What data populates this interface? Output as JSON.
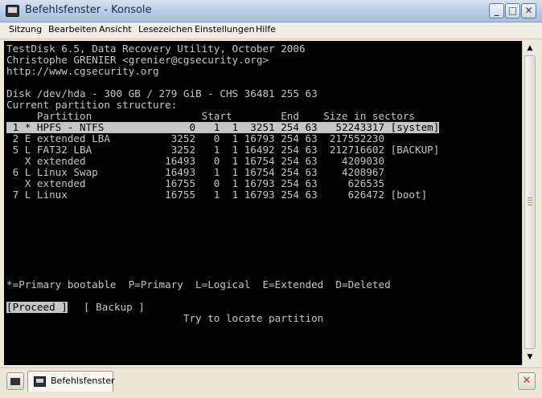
{
  "window": {
    "title": "Befehlsfenster - Konsole",
    "buttons": {
      "minimize": "_",
      "maximize": "□",
      "close": "✕"
    }
  },
  "menu": [
    "Sitzung",
    "Bearbeiten",
    "Ansicht",
    "Lesezeichen",
    "Einstellungen",
    "Hilfe"
  ],
  "terminal": {
    "lines": [
      "TestDisk 6.5, Data Recovery Utility, October 2006",
      "Christophe GRENIER <grenier@cgsecurity.org>",
      "http://www.cgsecurity.org",
      "",
      "Disk /dev/hda - 300 GB / 279 GiB - CHS 36481 255 63",
      "Current partition structure:",
      "     Partition                  Start        End    Size in sectors",
      " 1 * HPFS - NTFS              0   1  1  3251 254 63   52243317 [system]",
      " 2 E extended LBA          3252   0  1 16793 254 63  217552230",
      " 5 L FAT32 LBA             3252   1  1 16492 254 63  212716602 [BACKUP]",
      "   X extended             16493   0  1 16754 254 63    4209030",
      " 6 L Linux Swap           16493   1  1 16754 254 63    4208967",
      "   X extended             16755   0  1 16793 254 63     626535",
      " 7 L Linux                16755   1  1 16793 254 63     626472 [boot]",
      "",
      "",
      "",
      "",
      "*=Primary bootable  P=Primary  L=Logical  E=Extended  D=Deleted",
      "",
      "",
      "                             Try to locate partition"
    ],
    "proceed_button": "[Proceed ]",
    "backup_button": "[ Backup ]"
  },
  "tabs": {
    "new_tab_icon": "konsole-icon",
    "active_tab_label": "Befehlsfenster",
    "close_tab_icon": "close-tab-icon"
  }
}
